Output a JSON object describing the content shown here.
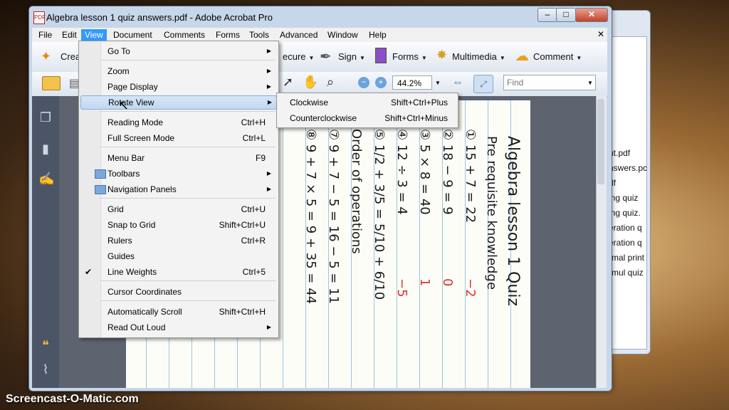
{
  "window": {
    "title": "Algebra lesson 1 quiz answers.pdf - Adobe Acrobat Pro",
    "minimize": "–",
    "maximize": "□",
    "close": "✕"
  },
  "menubar": [
    "File",
    "Edit",
    "View",
    "Document",
    "Comments",
    "Forms",
    "Tools",
    "Advanced",
    "Window",
    "Help"
  ],
  "toolbar1": {
    "create": "Crea",
    "secure": "ecure",
    "sign": "Sign",
    "forms": "Forms",
    "multimedia": "Multimedia",
    "comment": "Comment"
  },
  "toolbar2": {
    "zoom": "44.2%",
    "find_placeholder": "Find"
  },
  "view_menu": [
    {
      "label": "Go To",
      "shortcut": "",
      "submenu": true
    },
    {
      "label": "Zoom",
      "shortcut": "",
      "submenu": true
    },
    {
      "label": "Page Display",
      "shortcut": "",
      "submenu": true
    },
    {
      "label": "Rotate View",
      "shortcut": "",
      "submenu": true
    },
    {
      "label": "Reading Mode",
      "shortcut": "Ctrl+H",
      "submenu": false
    },
    {
      "label": "Full Screen Mode",
      "shortcut": "Ctrl+L",
      "submenu": false
    },
    {
      "label": "Menu Bar",
      "shortcut": "F9",
      "submenu": false
    },
    {
      "label": "Toolbars",
      "shortcut": "",
      "submenu": true
    },
    {
      "label": "Navigation Panels",
      "shortcut": "",
      "submenu": true
    },
    {
      "label": "Grid",
      "shortcut": "Ctrl+U",
      "submenu": false
    },
    {
      "label": "Snap to Grid",
      "shortcut": "Shift+Ctrl+U",
      "submenu": false
    },
    {
      "label": "Rulers",
      "shortcut": "Ctrl+R",
      "submenu": false
    },
    {
      "label": "Guides",
      "shortcut": "",
      "submenu": false
    },
    {
      "label": "Line Weights",
      "shortcut": "Ctrl+5",
      "submenu": false,
      "checked": true
    },
    {
      "label": "Cursor Coordinates",
      "shortcut": "",
      "submenu": false
    },
    {
      "label": "Automatically Scroll",
      "shortcut": "Shift+Ctrl+H",
      "submenu": false
    },
    {
      "label": "Read Out Loud",
      "shortcut": "",
      "submenu": true
    }
  ],
  "rotate_submenu": [
    {
      "label": "Clockwise",
      "shortcut": "Shift+Ctrl+Plus"
    },
    {
      "label": "Counterclockwise",
      "shortcut": "Shift+Ctrl+Minus"
    }
  ],
  "background_window": {
    "files": [
      "ut.pdf",
      "nswers.pc",
      "df",
      "ing quiz",
      "ing quiz.",
      "eration q",
      "eration q",
      "rmal print",
      "rmul quiz"
    ]
  },
  "document": {
    "title": "Algebra lesson 1 Quiz",
    "subtitle": "Pre requisite knowledge",
    "lines": [
      "① 15 + 7 = 22",
      "② 18 − 9 = 9",
      "③ 5 × 8 = 40",
      "④ 12 ÷ 3 = 4",
      "⑤ 1/2 + 3/5 = 5/10 + 6/10",
      "Order of operations",
      "⑦ 9 + 7 − 5 = 16 − 5 = 11",
      "⑧ 9 + 7 × 5 = 9 + 35 = 44"
    ],
    "red_answers": [
      "−2",
      "0",
      "1",
      "−5"
    ]
  },
  "watermark": "Screencast-O-Matic.com"
}
